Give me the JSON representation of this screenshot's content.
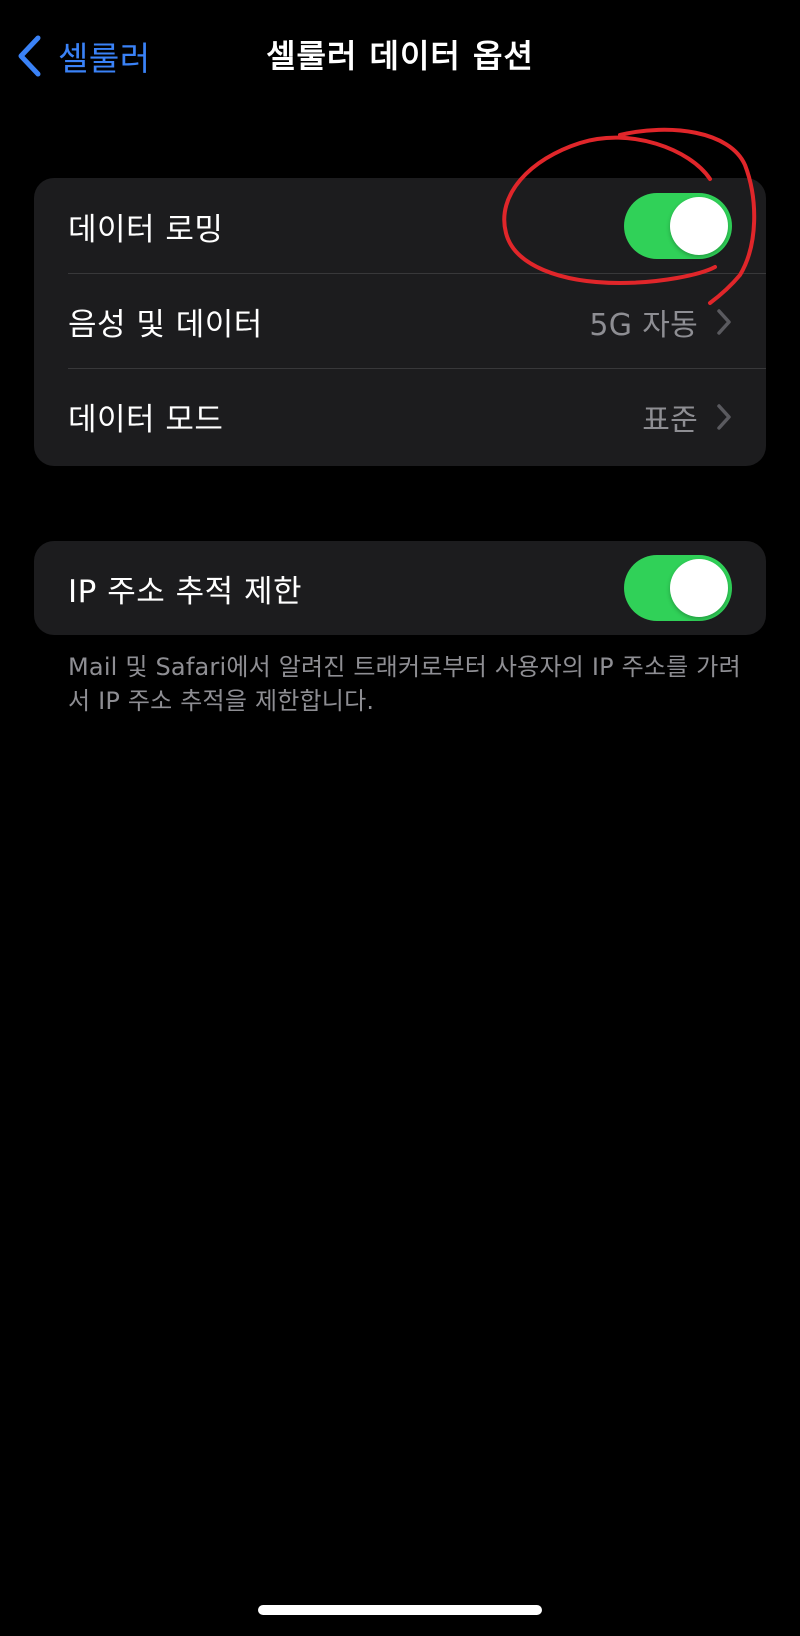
{
  "nav": {
    "back_label": "셀룰러",
    "title": "셀룰러 데이터 옵션"
  },
  "group1": {
    "rows": [
      {
        "label": "데이터 로밍",
        "toggle_on": true
      },
      {
        "label": "음성 및 데이터",
        "value": "5G 자동"
      },
      {
        "label": "데이터 모드",
        "value": "표준"
      }
    ]
  },
  "group2": {
    "rows": [
      {
        "label": "IP 주소 추적 제한",
        "toggle_on": true
      }
    ],
    "footer": "Mail 및 Safari에서 알려진 트래커로부터 사용자의 IP 주소를 가려서 IP 주소 추적을 제한합니다."
  },
  "colors": {
    "accent": "#3a82f7",
    "toggle_on": "#30d158",
    "annotation": "#e0262a"
  }
}
